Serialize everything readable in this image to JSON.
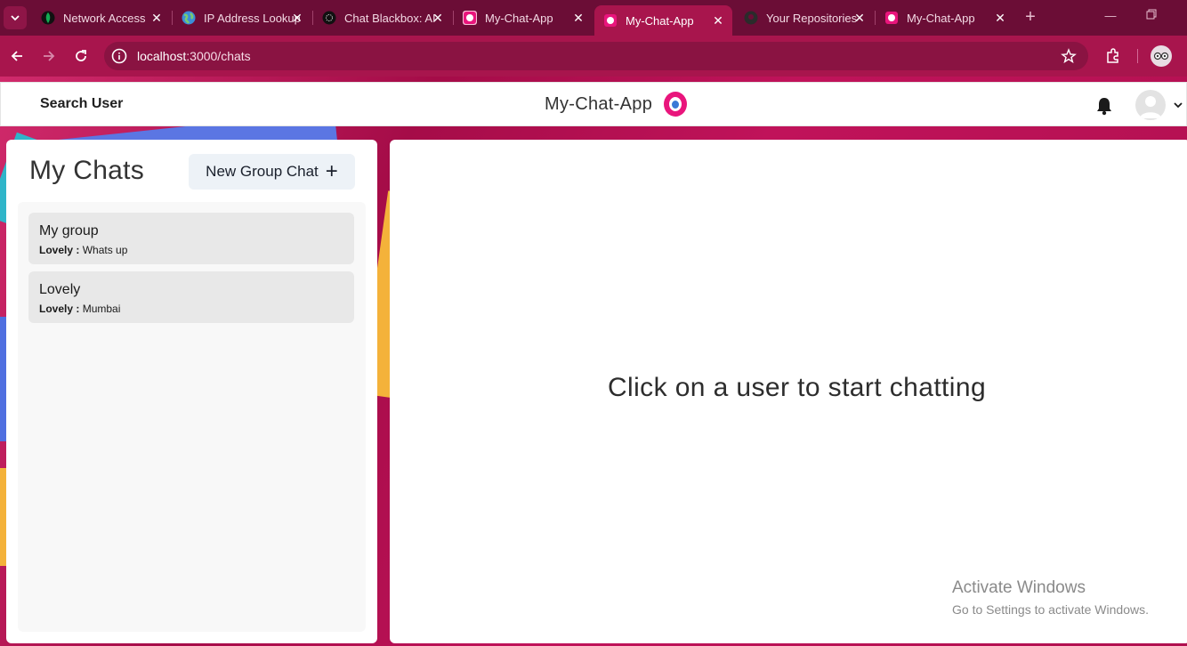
{
  "browser": {
    "tabs": [
      {
        "title": "Network Access",
        "favicon": "mongodb-leaf-icon",
        "active": false
      },
      {
        "title": "IP Address Lookup",
        "favicon": "globe-icon",
        "active": false
      },
      {
        "title": "Chat Blackbox: AI",
        "favicon": "blackbox-icon",
        "active": false
      },
      {
        "title": "My-Chat-App",
        "favicon": "chat-app-icon",
        "active": false
      },
      {
        "title": "My-Chat-App",
        "favicon": "chat-app-icon",
        "active": true
      },
      {
        "title": "Your Repositories",
        "favicon": "github-icon",
        "active": false
      },
      {
        "title": "My-Chat-App",
        "favicon": "chat-app-icon",
        "active": false
      }
    ],
    "address": {
      "host": "localhost",
      "path": ":3000/chats"
    },
    "colors": {
      "frame": "#6b0d36",
      "toolbar": "#a8154d",
      "omnibox": "#8a1342"
    }
  },
  "header": {
    "search_label": "Search User",
    "app_title": "My-Chat-App"
  },
  "sidebar": {
    "title": "My Chats",
    "new_group_label": "New Group Chat",
    "chats": [
      {
        "name": "My group",
        "sender": "Lovely :",
        "message": "Whats up"
      },
      {
        "name": "Lovely",
        "sender": "Lovely :",
        "message": "Mumbai"
      }
    ]
  },
  "main": {
    "placeholder": "Click on a user to start chatting"
  },
  "watermark": {
    "line1": "Activate Windows",
    "line2": "Go to Settings to activate Windows."
  }
}
